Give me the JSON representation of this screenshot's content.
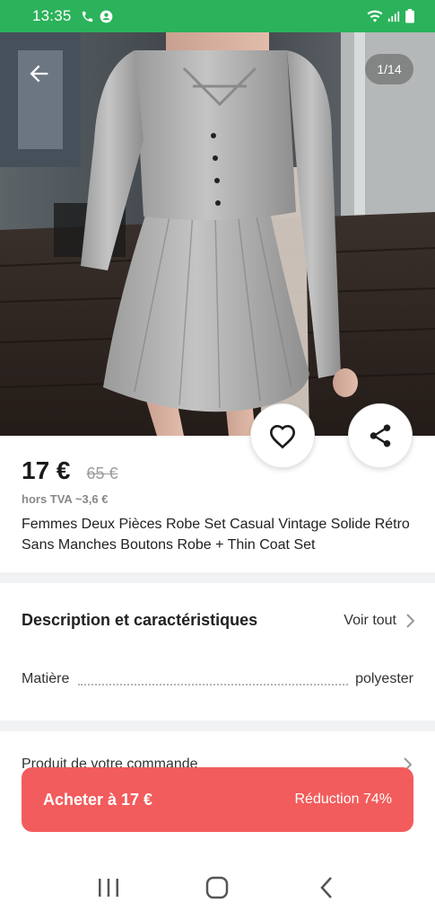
{
  "status_bar": {
    "time": "13:35",
    "icons_left": [
      "phone-icon",
      "account-icon"
    ],
    "icons_right": [
      "wifi-icon",
      "signal-icon",
      "battery-icon"
    ],
    "background": "#2bb25a"
  },
  "gallery": {
    "page_indicator": "1/14",
    "back_icon": "arrow-left-icon",
    "favorite_icon": "heart-outline-icon",
    "share_icon": "share-icon"
  },
  "product": {
    "price": "17 €",
    "old_price": "65 €",
    "vat_text": "hors TVA ~3,6 €",
    "title": "Femmes Deux Pièces Robe Set Casual Vintage Solide Rétro Sans Manches Boutons Robe + Thin Coat Set"
  },
  "description": {
    "title": "Description et caractéristiques",
    "see_all": "Voir tout",
    "attributes": [
      {
        "name": "Matière",
        "value": "polyester"
      }
    ]
  },
  "order_section": {
    "label": "Produit de votre commande"
  },
  "buy_button": {
    "label": "Acheter à 17 €",
    "discount": "Réduction 74%",
    "color": "#f25c5c"
  },
  "nav_bar": {
    "icons": [
      "recent-apps-icon",
      "home-icon",
      "back-icon"
    ]
  }
}
